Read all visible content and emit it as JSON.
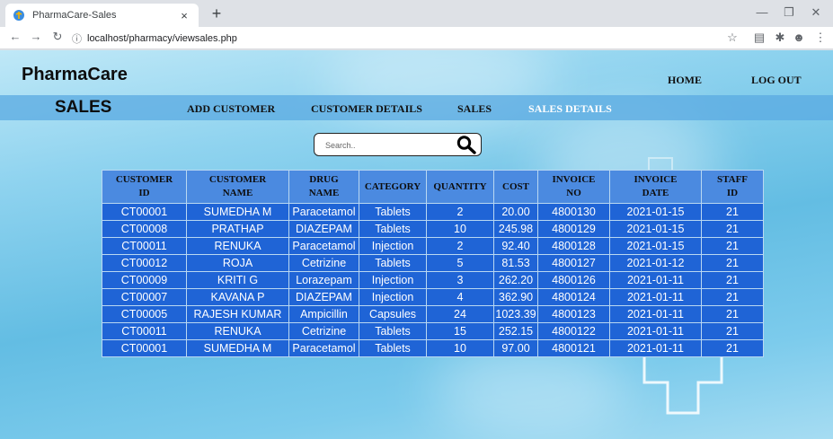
{
  "browser": {
    "tab_title": "PharmaCare-Sales",
    "tab_close": "×",
    "new_tab": "+",
    "url": "localhost/pharmacy/viewsales.php"
  },
  "header": {
    "brand": "PharmaCare",
    "home_label": "HOME",
    "logout_label": "LOG OUT"
  },
  "menu": {
    "title": "SALES",
    "items": [
      "ADD CUSTOMER",
      "CUSTOMER DETAILS",
      "SALES",
      "SALES DETAILS"
    ],
    "active_item": "SALES DETAILS"
  },
  "search": {
    "placeholder": "Search.."
  },
  "table": {
    "headers": [
      [
        "CUSTOMER",
        "ID"
      ],
      [
        "CUSTOMER",
        "NAME"
      ],
      [
        "DRUG",
        "NAME"
      ],
      [
        "CATEGORY",
        ""
      ],
      [
        "QUANTITY",
        ""
      ],
      [
        "COST",
        ""
      ],
      [
        "INVOICE",
        "NO"
      ],
      [
        "INVOICE",
        "DATE"
      ],
      [
        "STAFF",
        "ID"
      ]
    ],
    "rows": [
      [
        "CT00001",
        "SUMEDHA M",
        "Paracetamol",
        "Tablets",
        "2",
        "20.00",
        "4800130",
        "2021-01-15",
        "21"
      ],
      [
        "CT00008",
        "PRATHAP",
        "DIAZEPAM",
        "Tablets",
        "10",
        "245.98",
        "4800129",
        "2021-01-15",
        "21"
      ],
      [
        "CT00011",
        "RENUKA",
        "Paracetamol",
        "Injection",
        "2",
        "92.40",
        "4800128",
        "2021-01-15",
        "21"
      ],
      [
        "CT00012",
        "ROJA",
        "Cetrizine",
        "Tablets",
        "5",
        "81.53",
        "4800127",
        "2021-01-12",
        "21"
      ],
      [
        "CT00009",
        "KRITI G",
        "Lorazepam",
        "Injection",
        "3",
        "262.20",
        "4800126",
        "2021-01-11",
        "21"
      ],
      [
        "CT00007",
        "KAVANA P",
        "DIAZEPAM",
        "Injection",
        "4",
        "362.90",
        "4800124",
        "2021-01-11",
        "21"
      ],
      [
        "CT00005",
        "RAJESH KUMAR",
        "Ampicillin",
        "Capsules",
        "24",
        "1023.39",
        "4800123",
        "2021-01-11",
        "21"
      ],
      [
        "CT00011",
        "RENUKA",
        "Cetrizine",
        "Tablets",
        "15",
        "252.15",
        "4800122",
        "2021-01-11",
        "21"
      ],
      [
        "CT00001",
        "SUMEDHA M",
        "Paracetamol",
        "Tablets",
        "10",
        "97.00",
        "4800121",
        "2021-01-11",
        "21"
      ]
    ]
  },
  "colors": {
    "table_header_bg": "#4b8ae0",
    "table_cell_bg": "#1f64d6",
    "menubar_bg": "#5aaae1"
  }
}
